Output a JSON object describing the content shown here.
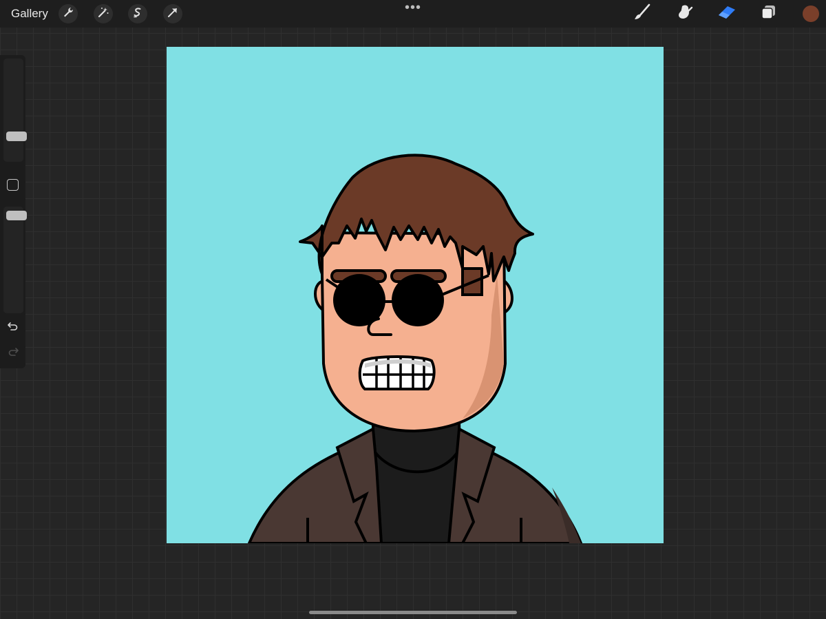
{
  "toolbar": {
    "gallery_label": "Gallery",
    "left_tools": [
      "wrench-icon",
      "magic-wand-icon",
      "selection-icon",
      "transform-icon"
    ],
    "more_icon": "ellipsis-icon",
    "more_label": "•••",
    "right_tools": [
      "brush-icon",
      "smudge-icon",
      "eraser-icon",
      "layers-icon"
    ],
    "active_tool": "eraser",
    "active_color": "#7a3f2a"
  },
  "sidebar": {
    "brush_size_level": 0.22,
    "opacity_level": 0.04,
    "modify_icon": "square-icon",
    "undo_icon": "undo-icon",
    "redo_icon": "redo-icon"
  },
  "canvas": {
    "background_color": "#80e0e4",
    "skin_color": "#f5b090",
    "hair_color": "#6b3a27",
    "jacket_color": "#4a3833",
    "shirt_color": "#1c1c1c"
  }
}
